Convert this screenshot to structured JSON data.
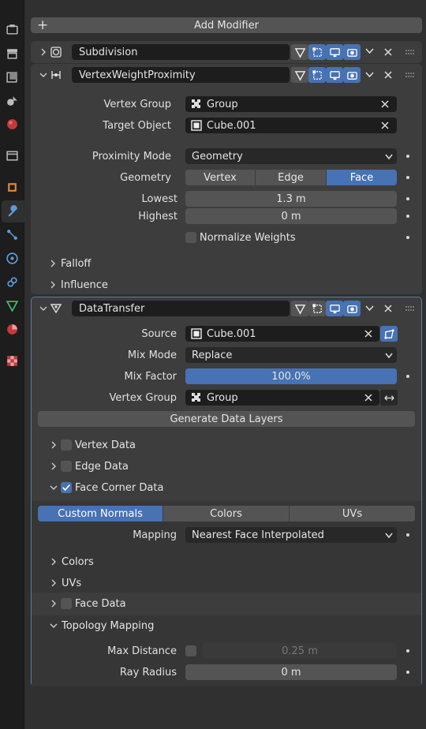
{
  "colors": {
    "accent": "#4772b3",
    "panel": "#303030",
    "card": "#3d3d3d",
    "field": "#1d1d1d",
    "button": "#545454"
  },
  "tabs": [
    "tool-icon",
    "render-icon",
    "output-icon",
    "view-layer-icon",
    "scene-icon",
    "world-icon",
    "collection-icon",
    "object-icon",
    "modifier-icon",
    "particles-icon",
    "physics-icon",
    "constraints-icon",
    "data-icon",
    "material-icon",
    "texture-icon"
  ],
  "header": {
    "add_modifier": "Add Modifier"
  },
  "modifiers": {
    "subdivision": {
      "name": "Subdivision"
    },
    "vwp": {
      "name": "VertexWeightProximity",
      "vertex_group_label": "Vertex Group",
      "vertex_group_value": "Group",
      "target_object_label": "Target Object",
      "target_object_value": "Cube.001",
      "proximity_mode_label": "Proximity Mode",
      "proximity_mode_value": "Geometry",
      "geometry_label": "Geometry",
      "geometry_options": [
        "Vertex",
        "Edge",
        "Face"
      ],
      "geometry_selected": "Face",
      "lowest_label": "Lowest",
      "lowest_value": "1.3 m",
      "highest_label": "Highest",
      "highest_value": "0 m",
      "normalize_label": "Normalize Weights",
      "falloff_label": "Falloff",
      "influence_label": "Influence"
    },
    "dt": {
      "name": "DataTransfer",
      "source_label": "Source",
      "source_value": "Cube.001",
      "mix_mode_label": "Mix Mode",
      "mix_mode_value": "Replace",
      "mix_factor_label": "Mix Factor",
      "mix_factor_value": "100.0%",
      "mix_factor_fraction": 1.0,
      "vertex_group_label": "Vertex Group",
      "vertex_group_value": "Group",
      "generate_label": "Generate Data Layers",
      "vertex_data_label": "Vertex Data",
      "edge_data_label": "Edge Data",
      "face_corner_label": "Face Corner Data",
      "fc_tabs": [
        "Custom Normals",
        "Colors",
        "UVs"
      ],
      "fc_selected": "Custom Normals",
      "mapping_label": "Mapping",
      "mapping_value": "Nearest Face Interpolated",
      "colors_label": "Colors",
      "uvs_label": "UVs",
      "face_data_label": "Face Data",
      "topology_label": "Topology Mapping",
      "max_distance_label": "Max Distance",
      "max_distance_value": "0.25 m",
      "ray_radius_label": "Ray Radius",
      "ray_radius_value": "0 m"
    }
  }
}
